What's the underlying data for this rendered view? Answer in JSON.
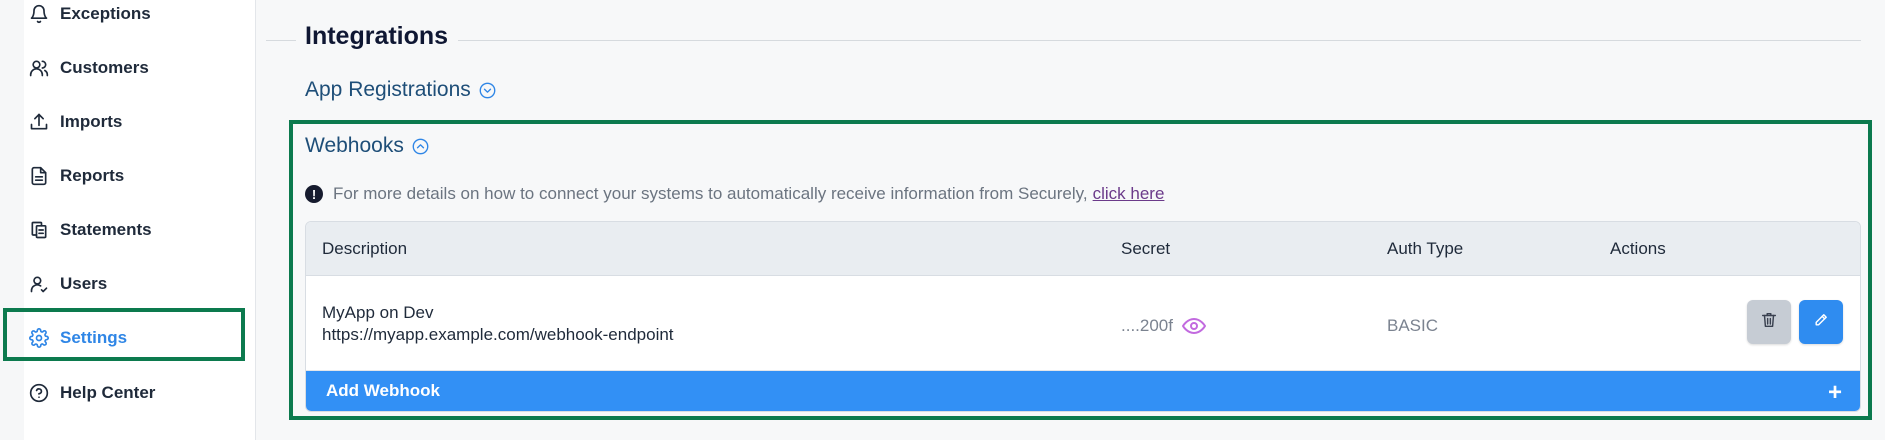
{
  "sidebar": {
    "items": [
      {
        "label": "Exceptions",
        "icon": "bell-icon"
      },
      {
        "label": "Customers",
        "icon": "users-icon"
      },
      {
        "label": "Imports",
        "icon": "upload-icon"
      },
      {
        "label": "Reports",
        "icon": "document-icon"
      },
      {
        "label": "Statements",
        "icon": "copy-icon"
      },
      {
        "label": "Users",
        "icon": "user-check-icon"
      },
      {
        "label": "Settings",
        "icon": "gear-icon",
        "active": true
      },
      {
        "label": "Help Center",
        "icon": "question-circle-icon"
      }
    ]
  },
  "main": {
    "section_title": "Integrations",
    "app_registrations": {
      "label": "App Registrations",
      "expanded": false
    },
    "webhooks": {
      "label": "Webhooks",
      "expanded": true,
      "info": {
        "text": "For more details on how to connect your systems to automatically receive information from Securely,",
        "link_text": "click here"
      },
      "table": {
        "columns": [
          "Description",
          "Secret",
          "Auth Type",
          "Actions"
        ],
        "rows": [
          {
            "name": "MyApp on Dev",
            "url": "https://myapp.example.com/webhook-endpoint",
            "secret": "....200f",
            "auth_type": "BASIC"
          }
        ]
      },
      "add_label": "Add Webhook",
      "add_symbol": "+"
    }
  },
  "colors": {
    "accent": "#2f86e6",
    "highlight_outline": "#0c7a4e",
    "add_bar": "#3290f5"
  }
}
